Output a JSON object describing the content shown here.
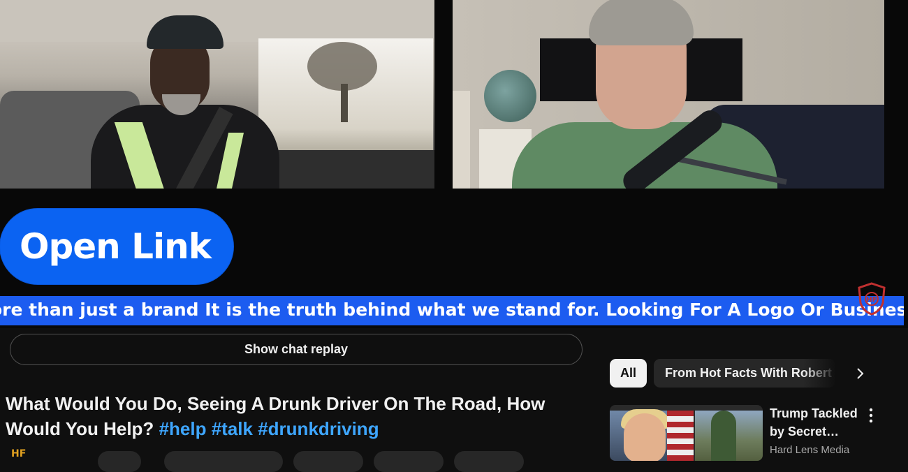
{
  "video": {
    "overlay_button_label": "Open Link",
    "ticker_text": "ore than just a brand It is the truth behind what we stand for. Looking For A Logo Or Business Cards Or An"
  },
  "chat": {
    "replay_button_label": "Show chat replay"
  },
  "video_title": {
    "text": "What Would You Do, Seeing A Drunk Driver On The Road, How Would You Help?",
    "hashtags": [
      "#help",
      "#talk",
      "#drunkdriving"
    ]
  },
  "recommendations": {
    "chips": [
      {
        "label": "All",
        "selected": true
      },
      {
        "label": "From Hot Facts With Robert R",
        "selected": false
      }
    ],
    "items": [
      {
        "title": "Trump Tackled by Secret…",
        "channel": "Hard Lens Media"
      }
    ]
  },
  "colors": {
    "background": "#0f0f0f",
    "overlay_button": "#0b63f2",
    "ticker_bar": "#1c5cf0",
    "hashtag": "#3ea6ff",
    "chip_selected": "#f1f1f1",
    "chip": "#272727"
  },
  "icons": [
    "chevron-right-icon",
    "more-vert-icon",
    "channel-logo-icon",
    "brand-shield-logo-icon"
  ]
}
